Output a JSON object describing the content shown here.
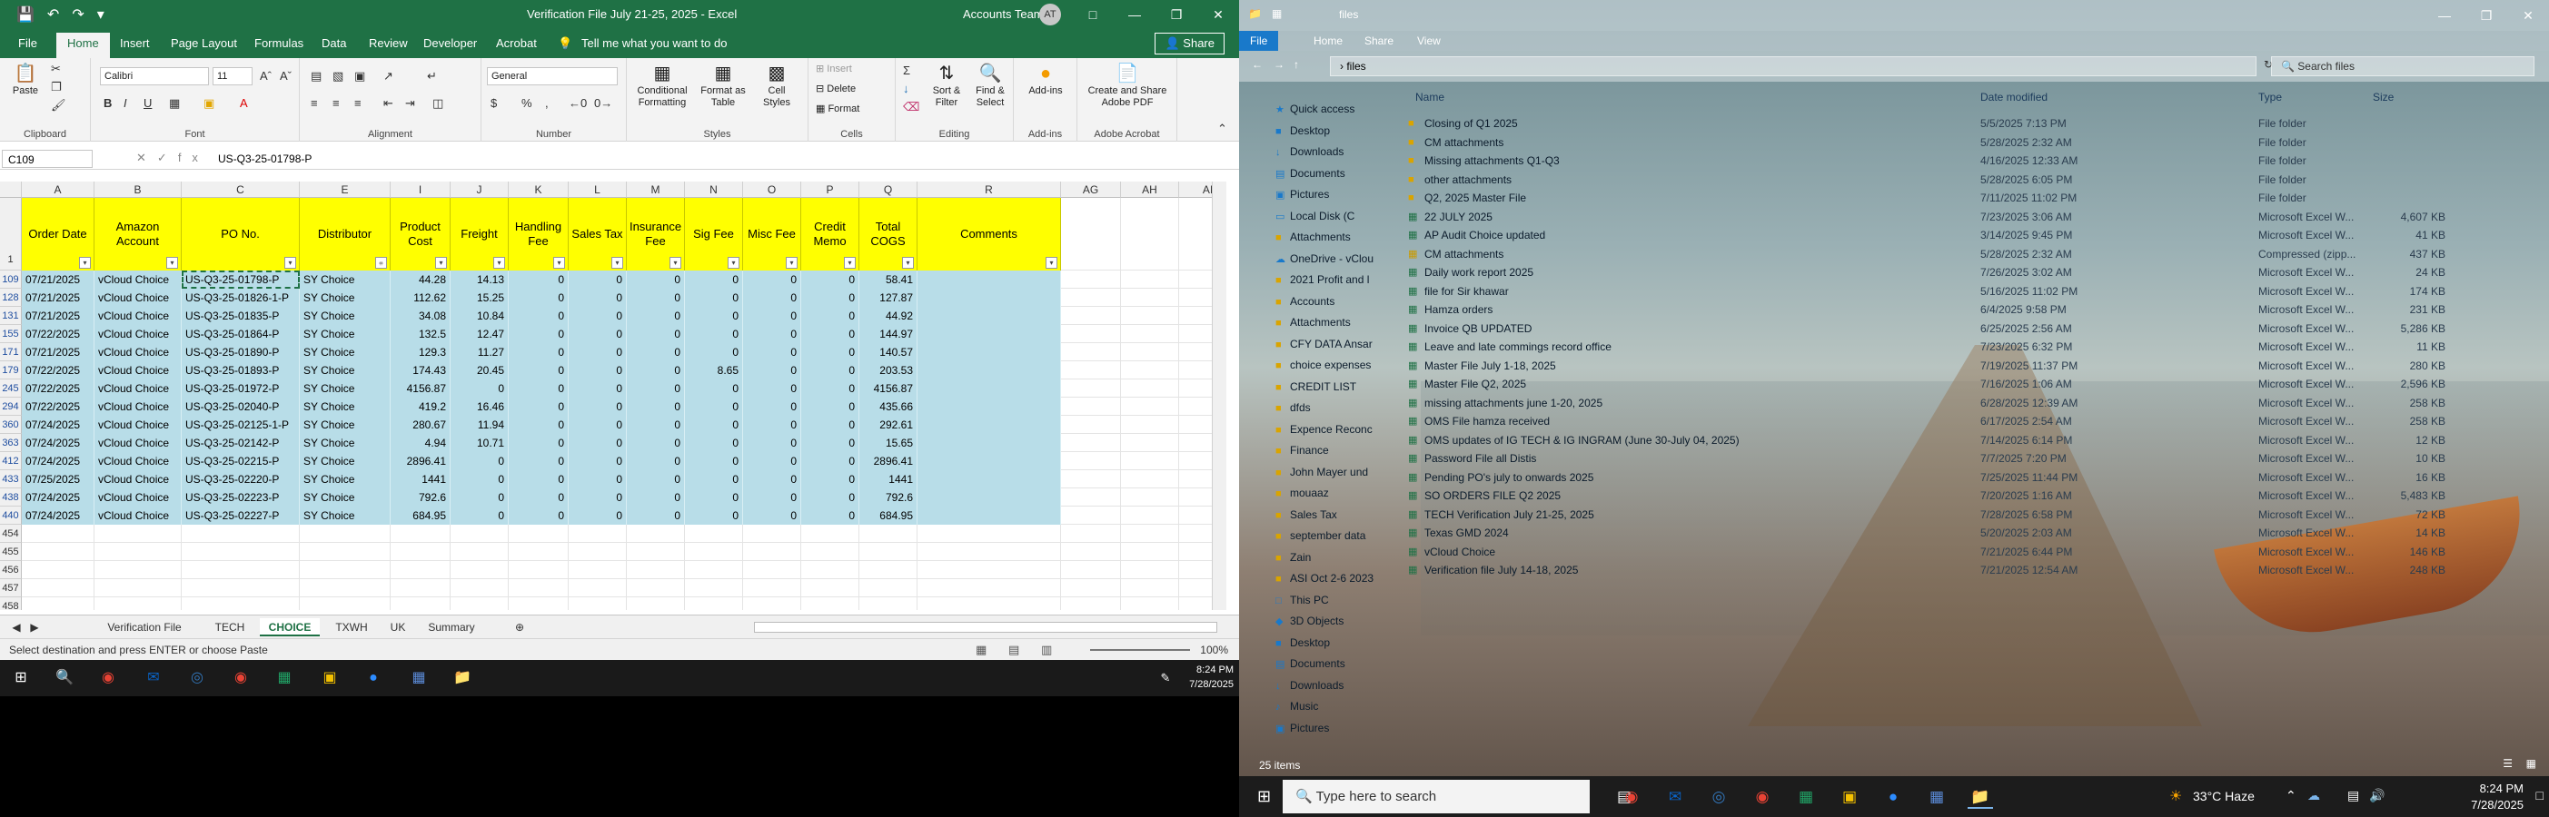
{
  "excel": {
    "title": "Verification File July 21-25, 2025  -  Excel",
    "account": "Accounts Team",
    "avatar": "AT",
    "tabs": [
      "File",
      "Home",
      "Insert",
      "Page Layout",
      "Formulas",
      "Data",
      "Review",
      "Developer",
      "Acrobat"
    ],
    "active_tab": "Home",
    "tell_me": "Tell me what you want to do",
    "share": "Share",
    "ribbon": {
      "paste": "Paste",
      "font_name": "Calibri",
      "font_size": "11",
      "number_format": "General",
      "conditional": "Conditional Formatting",
      "format_table": "Format as Table",
      "cell_styles": "Cell Styles",
      "insert": "Insert",
      "delete": "Delete",
      "format": "Format",
      "sort_filter": "Sort & Filter",
      "find_select": "Find & Select",
      "add_ins": "Add-ins",
      "create_pdf": "Create and Share Adobe PDF",
      "groups": [
        "Clipboard",
        "Font",
        "Alignment",
        "Number",
        "Styles",
        "Cells",
        "Editing",
        "Add-ins",
        "Adobe Acrobat"
      ]
    },
    "name_box": "C109",
    "formula": "US-Q3-25-01798-P",
    "columns": [
      "A",
      "B",
      "C",
      "E",
      "I",
      "J",
      "K",
      "L",
      "M",
      "N",
      "O",
      "P",
      "Q",
      "R",
      "AG",
      "AH",
      "AI"
    ],
    "headers": [
      "Order Date",
      "Amazon Account",
      "PO No.",
      "Distributor",
      "Product Cost",
      "Freight",
      "Handling Fee",
      "Sales Tax",
      "Insurance Fee",
      "Sig Fee",
      "Misc Fee",
      "Credit Memo",
      "Total COGS",
      "Comments"
    ],
    "header_row_num": "1",
    "rows": [
      {
        "r": "109",
        "cells": [
          "07/21/2025",
          "vCloud Choice",
          "US-Q3-25-01798-P",
          "SY Choice",
          "44.28",
          "14.13",
          "0",
          "0",
          "0",
          "0",
          "0",
          "0",
          "58.41"
        ]
      },
      {
        "r": "128",
        "cells": [
          "07/21/2025",
          "vCloud Choice",
          "US-Q3-25-01826-1-P",
          "SY Choice",
          "112.62",
          "15.25",
          "0",
          "0",
          "0",
          "0",
          "0",
          "0",
          "127.87"
        ]
      },
      {
        "r": "131",
        "cells": [
          "07/21/2025",
          "vCloud Choice",
          "US-Q3-25-01835-P",
          "SY Choice",
          "34.08",
          "10.84",
          "0",
          "0",
          "0",
          "0",
          "0",
          "0",
          "44.92"
        ]
      },
      {
        "r": "155",
        "cells": [
          "07/22/2025",
          "vCloud Choice",
          "US-Q3-25-01864-P",
          "SY Choice",
          "132.5",
          "12.47",
          "0",
          "0",
          "0",
          "0",
          "0",
          "0",
          "144.97"
        ]
      },
      {
        "r": "171",
        "cells": [
          "07/21/2025",
          "vCloud Choice",
          "US-Q3-25-01890-P",
          "SY Choice",
          "129.3",
          "11.27",
          "0",
          "0",
          "0",
          "0",
          "0",
          "0",
          "140.57"
        ]
      },
      {
        "r": "179",
        "cells": [
          "07/22/2025",
          "vCloud Choice",
          "US-Q3-25-01893-P",
          "SY Choice",
          "174.43",
          "20.45",
          "0",
          "0",
          "0",
          "8.65",
          "0",
          "0",
          "203.53"
        ]
      },
      {
        "r": "245",
        "cells": [
          "07/22/2025",
          "vCloud Choice",
          "US-Q3-25-01972-P",
          "SY Choice",
          "4156.87",
          "0",
          "0",
          "0",
          "0",
          "0",
          "0",
          "0",
          "4156.87"
        ]
      },
      {
        "r": "294",
        "cells": [
          "07/22/2025",
          "vCloud Choice",
          "US-Q3-25-02040-P",
          "SY Choice",
          "419.2",
          "16.46",
          "0",
          "0",
          "0",
          "0",
          "0",
          "0",
          "435.66"
        ]
      },
      {
        "r": "360",
        "cells": [
          "07/24/2025",
          "vCloud Choice",
          "US-Q3-25-02125-1-P",
          "SY Choice",
          "280.67",
          "11.94",
          "0",
          "0",
          "0",
          "0",
          "0",
          "0",
          "292.61"
        ]
      },
      {
        "r": "363",
        "cells": [
          "07/24/2025",
          "vCloud Choice",
          "US-Q3-25-02142-P",
          "SY Choice",
          "4.94",
          "10.71",
          "0",
          "0",
          "0",
          "0",
          "0",
          "0",
          "15.65"
        ]
      },
      {
        "r": "412",
        "cells": [
          "07/24/2025",
          "vCloud Choice",
          "US-Q3-25-02215-P",
          "SY Choice",
          "2896.41",
          "0",
          "0",
          "0",
          "0",
          "0",
          "0",
          "0",
          "2896.41"
        ]
      },
      {
        "r": "433",
        "cells": [
          "07/25/2025",
          "vCloud Choice",
          "US-Q3-25-02220-P",
          "SY Choice",
          "1441",
          "0",
          "0",
          "0",
          "0",
          "0",
          "0",
          "0",
          "1441"
        ]
      },
      {
        "r": "438",
        "cells": [
          "07/24/2025",
          "vCloud Choice",
          "US-Q3-25-02223-P",
          "SY Choice",
          "792.6",
          "0",
          "0",
          "0",
          "0",
          "0",
          "0",
          "0",
          "792.6"
        ]
      },
      {
        "r": "440",
        "cells": [
          "07/24/2025",
          "vCloud Choice",
          "US-Q3-25-02227-P",
          "SY Choice",
          "684.95",
          "0",
          "0",
          "0",
          "0",
          "0",
          "0",
          "0",
          "684.95"
        ]
      }
    ],
    "empty_rows": [
      "454",
      "455",
      "456",
      "457",
      "458"
    ],
    "sheets": [
      "Verification File",
      "TECH",
      "CHOICE",
      "TXWH",
      "UK",
      "Summary"
    ],
    "active_sheet": "CHOICE",
    "status": "Select destination and press ENTER or choose Paste",
    "zoom": "100%"
  },
  "taskbar_left": {
    "time": "8:24 PM",
    "date": "7/28/2025"
  },
  "explorer": {
    "title": "files",
    "ribbon_tabs": [
      "File",
      "Home",
      "Share",
      "View"
    ],
    "path": "files",
    "search_placeholder": "Search files",
    "columns": [
      "Name",
      "Date modified",
      "Type",
      "Size"
    ],
    "nav": [
      "Quick access",
      "Desktop",
      "Downloads",
      "Documents",
      "Pictures",
      "Local Disk (C",
      "Attachments",
      "OneDrive - vClou",
      "2021 Profit and l",
      "Accounts",
      "Attachments",
      "CFY DATA Ansar",
      "choice expenses",
      "CREDIT LIST",
      "dfds",
      "Expence Reconc",
      "Finance",
      "John Mayer und",
      "mouaaz",
      "Sales Tax",
      "september data",
      "Zain",
      "ASI Oct 2-6 2023",
      "This PC",
      "3D Objects",
      "Desktop",
      "Documents",
      "Downloads",
      "Music",
      "Pictures"
    ],
    "files": [
      {
        "name": "Closing of Q1 2025",
        "date": "5/5/2025 7:13 PM",
        "type": "File folder",
        "size": ""
      },
      {
        "name": "CM attachments",
        "date": "5/28/2025 2:32 AM",
        "type": "File folder",
        "size": ""
      },
      {
        "name": "Missing attachments Q1-Q3",
        "date": "4/16/2025 12:33 AM",
        "type": "File folder",
        "size": ""
      },
      {
        "name": "other attachments",
        "date": "5/28/2025 6:05 PM",
        "type": "File folder",
        "size": ""
      },
      {
        "name": "Q2, 2025 Master File",
        "date": "7/11/2025 11:02 PM",
        "type": "File folder",
        "size": ""
      },
      {
        "name": "22 JULY 2025",
        "date": "7/23/2025 3:06 AM",
        "type": "Microsoft Excel W...",
        "size": "4,607 KB"
      },
      {
        "name": "AP Audit Choice updated",
        "date": "3/14/2025 9:45 PM",
        "type": "Microsoft Excel W...",
        "size": "41 KB"
      },
      {
        "name": "CM attachments",
        "date": "5/28/2025 2:32 AM",
        "type": "Compressed (zipp...",
        "size": "437 KB"
      },
      {
        "name": "Daily work report 2025",
        "date": "7/26/2025 3:02 AM",
        "type": "Microsoft Excel W...",
        "size": "24 KB"
      },
      {
        "name": "file for Sir khawar",
        "date": "5/16/2025 11:02 PM",
        "type": "Microsoft Excel W...",
        "size": "174 KB"
      },
      {
        "name": "Hamza orders",
        "date": "6/4/2025 9:58 PM",
        "type": "Microsoft Excel W...",
        "size": "231 KB"
      },
      {
        "name": "Invoice QB UPDATED",
        "date": "6/25/2025 2:56 AM",
        "type": "Microsoft Excel W...",
        "size": "5,286 KB"
      },
      {
        "name": "Leave and late commings record office",
        "date": "7/23/2025 6:32 PM",
        "type": "Microsoft Excel W...",
        "size": "11 KB"
      },
      {
        "name": "Master File July 1-18, 2025",
        "date": "7/19/2025 11:37 PM",
        "type": "Microsoft Excel W...",
        "size": "280 KB"
      },
      {
        "name": "Master File Q2, 2025",
        "date": "7/16/2025 1:06 AM",
        "type": "Microsoft Excel W...",
        "size": "2,596 KB"
      },
      {
        "name": "missing attachments june 1-20, 2025",
        "date": "6/28/2025 12:39 AM",
        "type": "Microsoft Excel W...",
        "size": "258 KB"
      },
      {
        "name": "OMS File hamza received",
        "date": "6/17/2025 2:54 AM",
        "type": "Microsoft Excel W...",
        "size": "258 KB"
      },
      {
        "name": "OMS updates of IG TECH & IG INGRAM (June 30-July 04, 2025)",
        "date": "7/14/2025 6:14 PM",
        "type": "Microsoft Excel W...",
        "size": "12 KB"
      },
      {
        "name": "Password File all Distis",
        "date": "7/7/2025 7:20 PM",
        "type": "Microsoft Excel W...",
        "size": "10 KB"
      },
      {
        "name": "Pending PO's july to onwards 2025",
        "date": "7/25/2025 11:44 PM",
        "type": "Microsoft Excel W...",
        "size": "16 KB"
      },
      {
        "name": "SO ORDERS FILE Q2 2025",
        "date": "7/20/2025 1:16 AM",
        "type": "Microsoft Excel W...",
        "size": "5,483 KB"
      },
      {
        "name": "TECH Verification July 21-25, 2025",
        "date": "7/28/2025 6:58 PM",
        "type": "Microsoft Excel W...",
        "size": "72 KB"
      },
      {
        "name": "Texas GMD 2024",
        "date": "5/20/2025 2:03 AM",
        "type": "Microsoft Excel W...",
        "size": "14 KB"
      },
      {
        "name": "vCloud Choice",
        "date": "7/21/2025 6:44 PM",
        "type": "Microsoft Excel W...",
        "size": "146 KB"
      },
      {
        "name": "Verification file July 14-18, 2025",
        "date": "7/21/2025 12:54 AM",
        "type": "Microsoft Excel W...",
        "size": "248 KB"
      }
    ],
    "item_count": "25 items"
  },
  "taskbar_right": {
    "search_placeholder": "Type here to search",
    "weather": "33°C  Haze",
    "time": "8:24 PM",
    "date": "7/28/2025"
  }
}
